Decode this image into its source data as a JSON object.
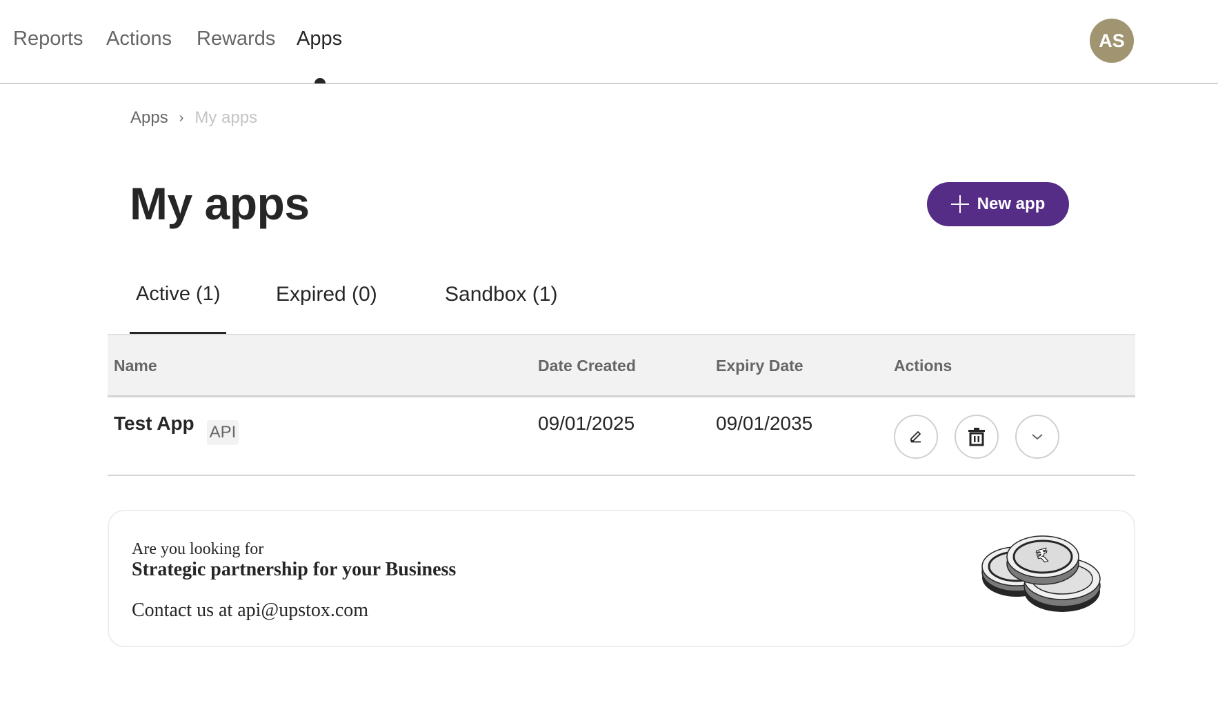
{
  "topnav": {
    "items": [
      {
        "label": "Reports",
        "active": false
      },
      {
        "label": "Actions",
        "active": false
      },
      {
        "label": "Rewards",
        "active": false
      },
      {
        "label": "Apps",
        "active": true
      }
    ],
    "avatar_initials": "AS",
    "avatar_color": "#a09570"
  },
  "breadcrumb": {
    "items": [
      "Apps",
      "My apps"
    ],
    "separator": "›"
  },
  "header": {
    "title": "My apps",
    "new_app_label": "New app",
    "new_app_icon": "plus-icon",
    "accent_color": "#552d87"
  },
  "tabs": [
    {
      "label": "Active (1)",
      "active": true
    },
    {
      "label": "Expired (0)",
      "active": false
    },
    {
      "label": "Sandbox (1)",
      "active": false
    }
  ],
  "table": {
    "columns": [
      "Name",
      "Date Created",
      "Expiry Date",
      "Actions"
    ],
    "rows": [
      {
        "name": "Test App",
        "badge": "API",
        "date_created": "09/01/2025",
        "expiry_date": "09/01/2035",
        "actions": [
          "edit-icon",
          "trash-icon",
          "chevron-down-icon"
        ]
      }
    ]
  },
  "promo": {
    "subtitle": "Are you looking for",
    "title": "Strategic partnership for your Business",
    "contact_prefix": "Contact us at ",
    "contact_email": "api@upstox.com",
    "illustration": "rupee-coins-icon"
  }
}
